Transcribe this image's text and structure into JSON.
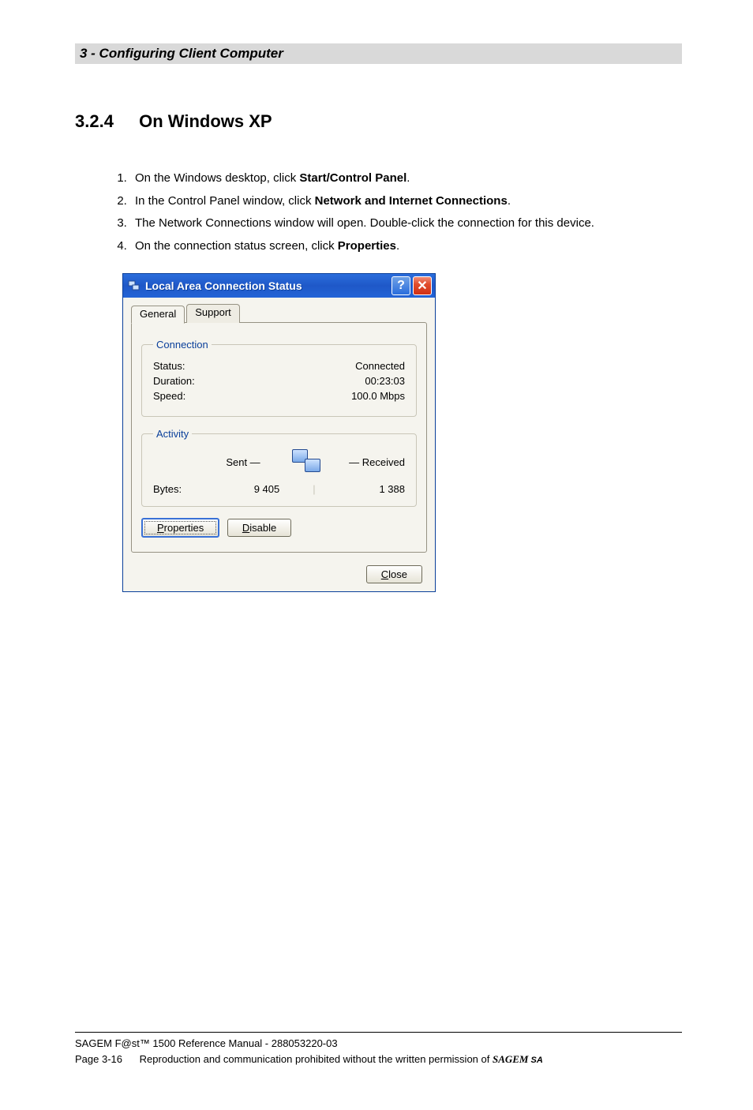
{
  "header": {
    "chapter": "3 - Configuring Client Computer"
  },
  "section": {
    "number": "3.2.4",
    "title": "On Windows XP"
  },
  "steps": [
    {
      "prefix": "On the Windows desktop, click ",
      "bold": "Start/Control Panel",
      "suffix": "."
    },
    {
      "prefix": "In the Control Panel window, click ",
      "bold": "Network and Internet Connections",
      "suffix": "."
    },
    {
      "prefix": "The Network Connections window will open. Double-click the connection for this device.",
      "bold": "",
      "suffix": ""
    },
    {
      "prefix": "On the connection status screen, click ",
      "bold": "Properties",
      "suffix": "."
    }
  ],
  "dialog": {
    "title": "Local Area Connection Status",
    "tabs": {
      "general": "General",
      "support": "Support"
    },
    "connection": {
      "legend": "Connection",
      "rows": {
        "status_label": "Status:",
        "status_value": "Connected",
        "duration_label": "Duration:",
        "duration_value": "00:23:03",
        "speed_label": "Speed:",
        "speed_value": "100.0 Mbps"
      }
    },
    "activity": {
      "legend": "Activity",
      "sent_label": "Sent",
      "received_label": "Received",
      "bytes_label": "Bytes:",
      "bytes_sent": "9 405",
      "bytes_received": "1 388"
    },
    "buttons": {
      "properties_u": "P",
      "properties_rest": "roperties",
      "disable_u": "D",
      "disable_rest": "isable",
      "close_u": "C",
      "close_rest": "lose"
    }
  },
  "footer": {
    "line1": "SAGEM F@st™ 1500 Reference Manual - 288053220-03",
    "page": "Page 3-16",
    "line2": "Reproduction and communication prohibited without the written permission of ",
    "brand": "SAGEM",
    "brand_suffix": " SA"
  }
}
